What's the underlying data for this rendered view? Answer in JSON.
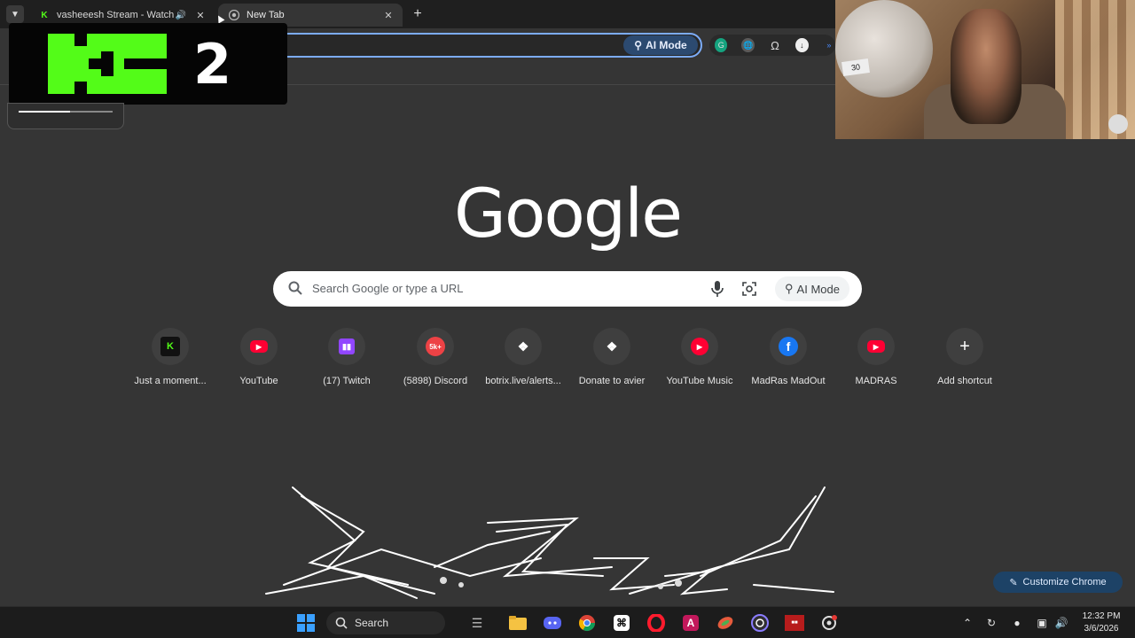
{
  "tabs": [
    {
      "title": "vasheeesh Stream - Watch Live on Kick",
      "favicon": "kick-icon",
      "active": false,
      "audio": true
    },
    {
      "title": "New Tab",
      "favicon": "chrome-icon",
      "active": true,
      "audio": false
    }
  ],
  "toolbar": {
    "ai_mode_label": "AI Mode",
    "extensions": [
      "grammarly-icon",
      "globe-icon",
      "omega-icon",
      "download-icon"
    ]
  },
  "kick_overlay": {
    "count": "2",
    "progress": 0.55
  },
  "webcam": {
    "plate_text": "30"
  },
  "google_logo": "Google",
  "search": {
    "placeholder": "Search Google or type a URL",
    "ai_mode_label": "AI Mode"
  },
  "shortcuts": [
    {
      "label": "Just a moment...",
      "icon": "kick-icon",
      "color": "#53fc18"
    },
    {
      "label": "YouTube",
      "icon": "youtube-icon",
      "color": "#ff0033"
    },
    {
      "label": "(17) Twitch",
      "icon": "twitch-icon",
      "color": "#9146ff"
    },
    {
      "label": "(5898) Discord",
      "icon": "discord-icon",
      "color": "#ed4245",
      "badge": "5k+"
    },
    {
      "label": "botrix.live/alerts...",
      "icon": "botrix-icon",
      "color": "#ffffff"
    },
    {
      "label": "Donate to avier",
      "icon": "botrix-icon",
      "color": "#ffffff"
    },
    {
      "label": "YouTube Music",
      "icon": "youtube-music-icon",
      "color": "#ff0033"
    },
    {
      "label": "MadRas MadOut",
      "icon": "facebook-icon",
      "color": "#1877f2"
    },
    {
      "label": "MADRAS",
      "icon": "youtube-icon",
      "color": "#ff0033"
    },
    {
      "label": "Add shortcut",
      "icon": "plus-icon",
      "color": "#ffffff"
    }
  ],
  "customize": {
    "label": "Customize Chrome"
  },
  "taskbar": {
    "search_label": "Search",
    "apps": [
      "windows-start-icon",
      "search-icon",
      "widgets-icon",
      "file-explorer-icon",
      "discord-icon",
      "chrome-icon",
      "capcut-icon",
      "opera-icon",
      "affinity-icon",
      "game-icon",
      "obs-icon",
      "news-icon",
      "settings-icon"
    ],
    "time": "12:32 PM",
    "date": "3/6/2026"
  }
}
